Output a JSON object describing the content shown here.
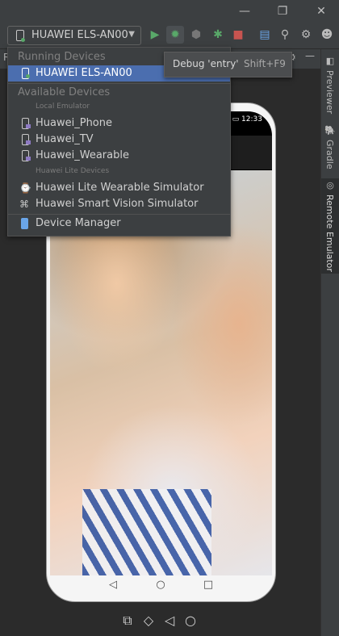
{
  "toolbar": {
    "device_selected": "HUAWEI ELS-AN00",
    "icons": [
      "run-icon",
      "debug-icon",
      "attach-debugger-icon",
      "debug-profile-icon",
      "stop-icon",
      "project-structure-icon",
      "search-icon",
      "settings-icon",
      "account-icon"
    ]
  },
  "tooltip": {
    "text": "Debug 'entry'",
    "shortcut": "Shift+F9"
  },
  "dropdown": {
    "running_header": "Running Devices",
    "running": [
      {
        "label": "HUAWEI ELS-AN00",
        "icon": "phone-icon"
      }
    ],
    "available_header": "Available Devices",
    "local_emulator_header": "Local Emulator",
    "local": [
      {
        "label": "Huawei_Phone",
        "icon": "phone-icon"
      },
      {
        "label": "Huawei_TV",
        "icon": "phone-icon"
      },
      {
        "label": "Huawei_Wearable",
        "icon": "phone-icon"
      }
    ],
    "lite_header": "Huawei Lite Devices",
    "lite": [
      {
        "label": "Huawei Lite Wearable Simulator",
        "icon": "watch-icon"
      },
      {
        "label": "Huawei Smart Vision Simulator",
        "icon": "camera-icon"
      }
    ],
    "manager": "Device Manager"
  },
  "side_tabs": [
    {
      "label": "Previewer",
      "icon": "previewer-icon"
    },
    {
      "label": "Gradle",
      "icon": "gradle-icon"
    },
    {
      "label": "Remote Emulator",
      "icon": "remote-emulator-icon",
      "active": true
    }
  ],
  "emulator": {
    "status": "100% ▭ 12:33",
    "panel_peek": "9",
    "panel_peek_left": "R",
    "nav": [
      "back-icon",
      "home-icon",
      "recents-icon"
    ]
  },
  "bottom_tools": [
    "screenshot-icon",
    "rotate-icon",
    "back-icon",
    "home-icon"
  ],
  "colors": {
    "accent": "#4b6eaf",
    "run": "#59a869",
    "stop": "#c75450",
    "debug": "#59a869"
  }
}
